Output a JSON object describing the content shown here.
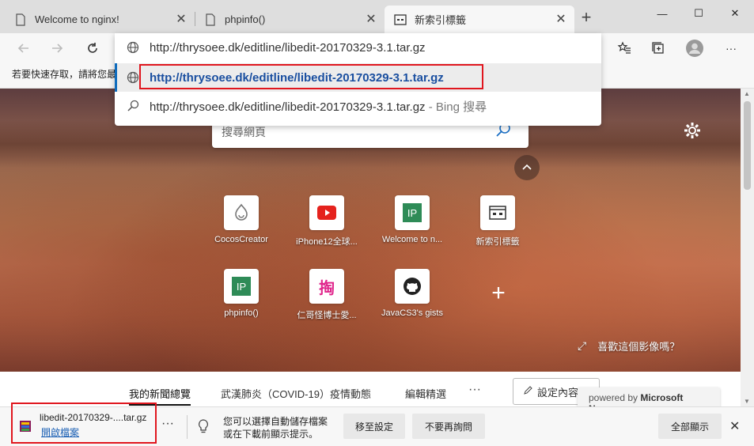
{
  "tabs": [
    {
      "title": "Welcome to nginx!",
      "icon": "page-icon"
    },
    {
      "title": "phpinfo()",
      "icon": "page-icon"
    },
    {
      "title": "新索引標籤",
      "icon": "newtab-icon",
      "active": true
    }
  ],
  "new_tab_label": "+",
  "window_controls": {
    "minimize": "—",
    "maximize": "☐",
    "close": "✕"
  },
  "toolbar": {
    "more": "···"
  },
  "bookmarks_hint": "若要快速存取，請將您最",
  "address_dropdown": {
    "rows": [
      {
        "text": "http://thrysoee.dk/editline/libedit-20170329-3.1.tar.gz",
        "icon": "globe-icon"
      },
      {
        "text": "http://thrysoee.dk/editline/libedit-20170329-3.1.tar.gz",
        "icon": "globe-icon",
        "selected": true
      },
      {
        "text": "http://thrysoee.dk/editline/libedit-20170329-3.1.tar.gz",
        "suffix": " - Bing 搜尋",
        "icon": "search-icon"
      }
    ]
  },
  "search": {
    "placeholder": "搜尋網頁"
  },
  "tiles": [
    {
      "label": "CocosCreator",
      "icon": "cocos-icon"
    },
    {
      "label": "iPhone12全球...",
      "icon": "youtube-icon"
    },
    {
      "label": "Welcome to n...",
      "icon": "ip-icon",
      "glyph": "IP"
    },
    {
      "label": "新索引標籤",
      "icon": "newtab-icon"
    },
    {
      "label": "phpinfo()",
      "icon": "ip-icon",
      "glyph": "IP"
    },
    {
      "label": "仁哥怪博士愛...",
      "icon": "tao-icon",
      "glyph": "掏"
    },
    {
      "label": "JavaCS3's gists",
      "icon": "github-icon"
    }
  ],
  "add_tile": "+",
  "like_image": {
    "expand": "⤢",
    "text": "喜歡這個影像嗎？"
  },
  "news": {
    "tabs": [
      "我的新聞總覽",
      "武漢肺炎（COVID-19）疫情動態",
      "編輯精選"
    ],
    "more": "···",
    "customize": "設定內容",
    "powered_prefix": "powered by ",
    "powered_brand": "Microsoft News"
  },
  "download": {
    "file_name": "libedit-20170329-....tar.gz",
    "open_label": "開啟檔案",
    "more": "···",
    "tip_line1": "您可以選擇自動儲存檔案",
    "tip_line2": "或在下載前顯示提示。",
    "settings_button": "移至設定",
    "dont_ask_button": "不要再詢問",
    "show_all_button": "全部顯示",
    "close": "✕"
  },
  "colors": {
    "accent_blue": "#0f6cbd",
    "highlight_red": "#e0161e"
  }
}
